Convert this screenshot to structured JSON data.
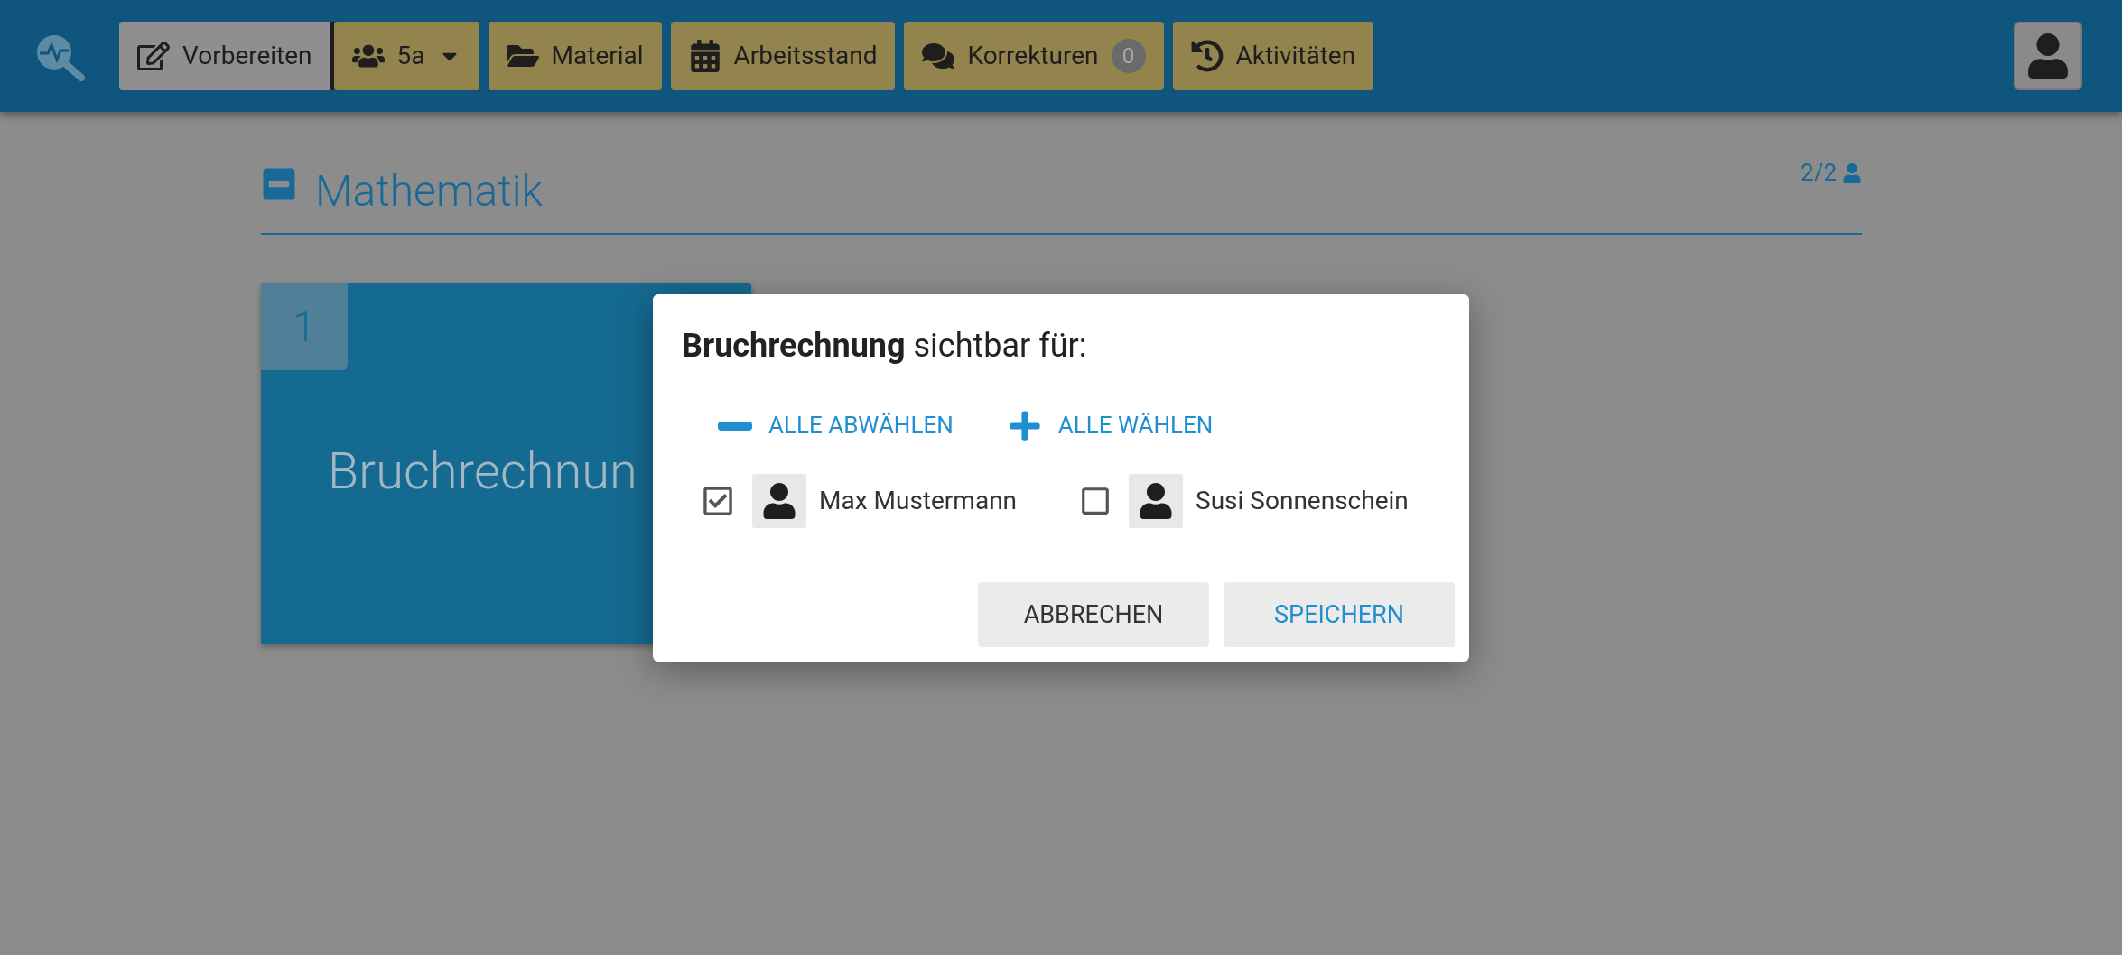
{
  "nav": [
    {
      "label": "Vorbereiten",
      "selected": true
    },
    {
      "label": "5a",
      "selected": false,
      "dropdown": true
    },
    {
      "label": "Material",
      "selected": false
    },
    {
      "label": "Arbeitsstand",
      "selected": false
    },
    {
      "label": "Korrekturen",
      "selected": false,
      "badge": "0"
    },
    {
      "label": "Aktivitäten",
      "selected": false
    }
  ],
  "section": {
    "title": "Mathematik",
    "expanded": true,
    "count": "2/2"
  },
  "cards": [
    {
      "number": "1",
      "title": "Bruchrechnun"
    }
  ],
  "dialog": {
    "title": "**Bruchrechnung** sichtbar für:",
    "actions": [
      {
        "kind": "deselect",
        "label": "ALLE ABWÄHLEN"
      },
      {
        "kind": "select",
        "label": "ALLE WÄHLEN"
      }
    ],
    "students": [
      {
        "name": "Max Mustermann",
        "checked": true
      },
      {
        "name": "Susi Sonnenschein",
        "checked": false
      }
    ],
    "buttons": [
      {
        "kind": "cancel",
        "label": "ABBRECHEN"
      },
      {
        "kind": "save",
        "label": "SPEICHERN"
      }
    ]
  }
}
